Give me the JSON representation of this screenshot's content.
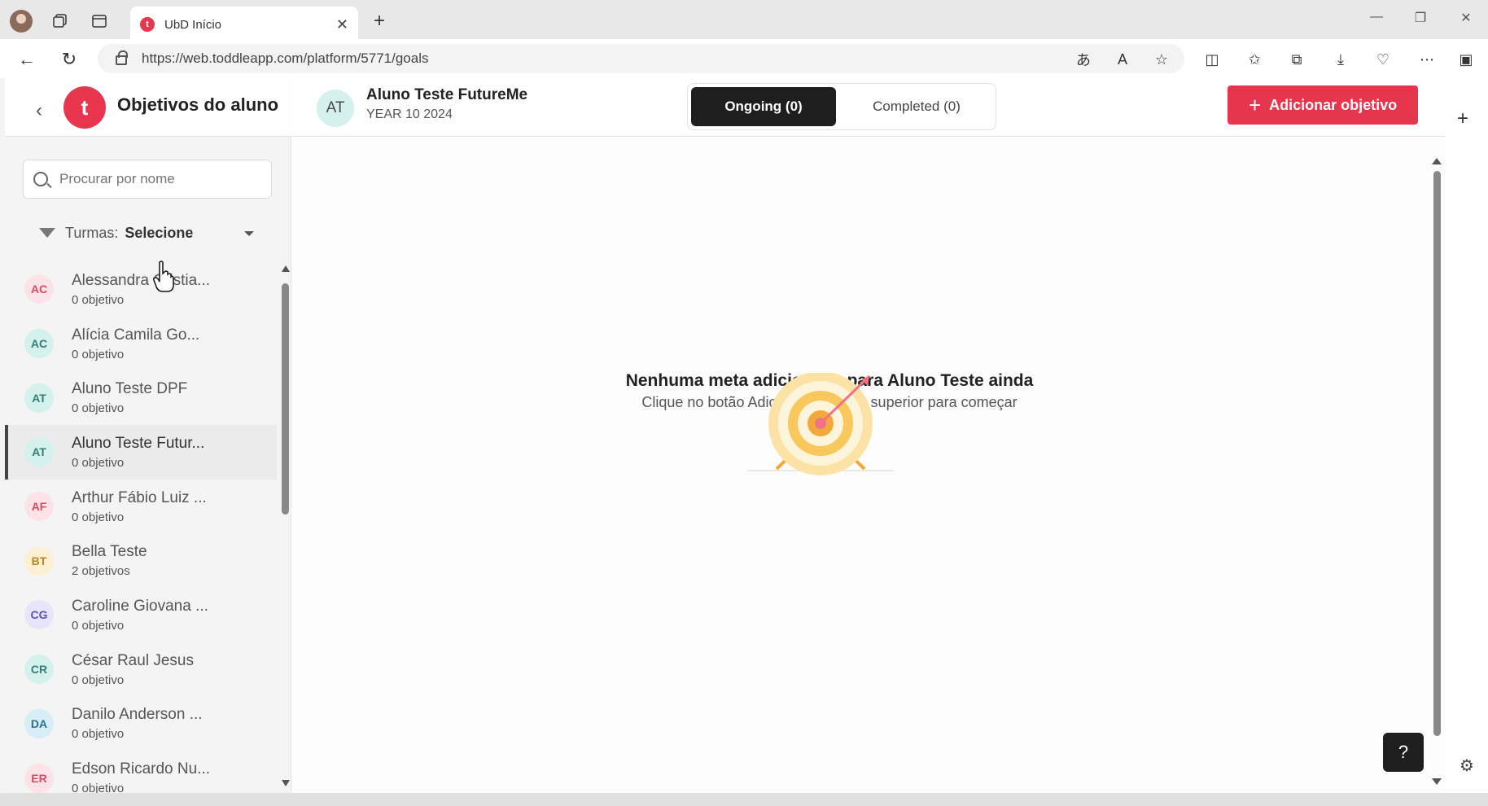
{
  "browser": {
    "tab_title": "UbD Início",
    "url": "https://web.toddleapp.com/platform/5771/goals"
  },
  "sidebar": {
    "title": "Objetivos do aluno",
    "logo_letter": "t",
    "search_placeholder": "Procurar por nome",
    "filter_label": "Turmas:",
    "filter_value": "Selecione",
    "students": [
      {
        "initials": "AC",
        "name": "Alessandra Cristia...",
        "count": "0 objetivo",
        "bg": "#fde3e7",
        "fg": "#d94a63"
      },
      {
        "initials": "AC",
        "name": "Alícia Camila Go...",
        "count": "0 objetivo",
        "bg": "#d4f1ee",
        "fg": "#2f7f77"
      },
      {
        "initials": "AT",
        "name": "Aluno Teste DPF",
        "count": "0 objetivo",
        "bg": "#d4f1ee",
        "fg": "#2f7f77"
      },
      {
        "initials": "AT",
        "name": "Aluno Teste Futur...",
        "count": "0 objetivo",
        "bg": "#d4f1ee",
        "fg": "#2f7f77"
      },
      {
        "initials": "AF",
        "name": "Arthur Fábio Luiz ...",
        "count": "0 objetivo",
        "bg": "#fde3e7",
        "fg": "#d94a63"
      },
      {
        "initials": "BT",
        "name": "Bella Teste",
        "count": "2 objetivos",
        "bg": "#fdf0d2",
        "fg": "#b7862a"
      },
      {
        "initials": "CG",
        "name": "Caroline Giovana ...",
        "count": "0 objetivo",
        "bg": "#e7e5fb",
        "fg": "#5a52b8"
      },
      {
        "initials": "CR",
        "name": "César Raul Jesus",
        "count": "0 objetivo",
        "bg": "#d4f1ee",
        "fg": "#2f7f77"
      },
      {
        "initials": "DA",
        "name": "Danilo Anderson ...",
        "count": "0 objetivo",
        "bg": "#d7edf7",
        "fg": "#2e6f8e"
      },
      {
        "initials": "ER",
        "name": "Edson Ricardo Nu...",
        "count": "0 objetivo",
        "bg": "#fde3e7",
        "fg": "#d94a63"
      }
    ]
  },
  "main": {
    "student_initials": "AT",
    "student_name": "Aluno Teste FutureMe",
    "student_class": "YEAR 10 2024",
    "tab_ongoing": "Ongoing (0)",
    "tab_completed": "Completed (0)",
    "add_button": "Adicionar objetivo",
    "empty_title": "Nenhuma meta adicionada para Aluno Teste ainda",
    "empty_subtitle": "Clique no botão Adicionar na parte superior para começar"
  },
  "help_label": "?"
}
